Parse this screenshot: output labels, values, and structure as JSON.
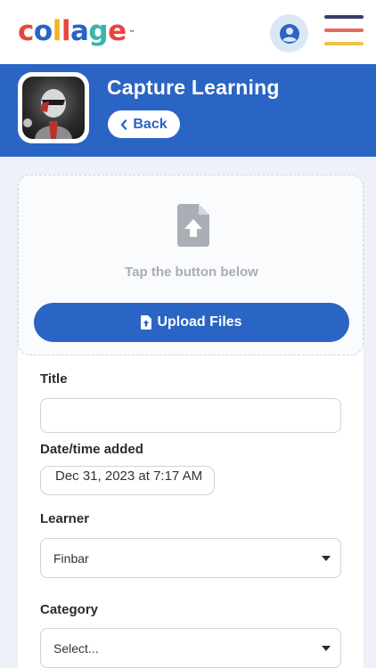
{
  "app": {
    "logo_letters": [
      "c",
      "o",
      "l",
      "l",
      "a",
      "g",
      "e"
    ],
    "logo_colors": [
      "#e8453c",
      "#2a64c4",
      "#f5b11f",
      "#e8453c",
      "#2a64c4",
      "#3ab5a8",
      "#e8453c"
    ],
    "logo_tm": "™",
    "profile_icon": "user-circle-icon",
    "menu_icon": "hamburger-menu-icon",
    "menu_line_colors": [
      "#3a3f63",
      "#e8675a",
      "#f2c04a"
    ]
  },
  "header": {
    "title": "Capture Learning",
    "back_label": "Back",
    "back_icon": "chevron-left-icon",
    "background": "#2a64c4"
  },
  "upload": {
    "icon": "file-upload-icon",
    "hint": "Tap the button below",
    "button_label": "Upload Files",
    "button_icon": "file-upload-icon"
  },
  "form": {
    "title_label": "Title",
    "title_value": "",
    "date_label": "Date/time added",
    "date_value": "Dec 31, 2023 at 7:17 AM",
    "learner_label": "Learner",
    "learner_value": "Finbar",
    "category_label": "Category",
    "category_value": "Select..."
  }
}
